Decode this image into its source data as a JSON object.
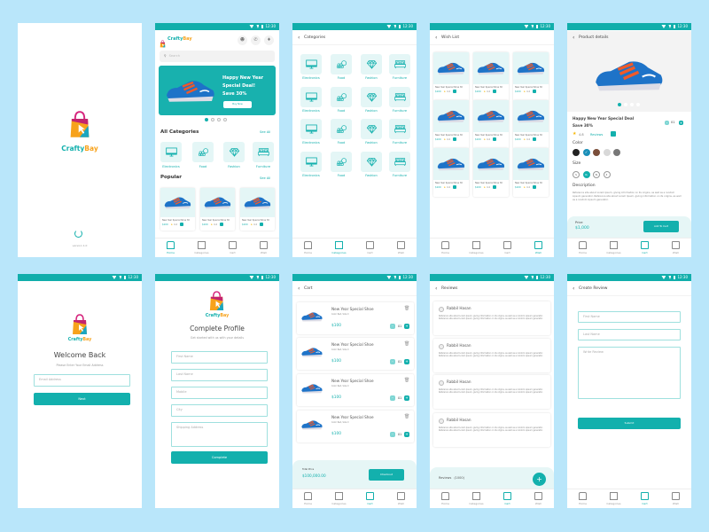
{
  "status": {
    "time": "12:30"
  },
  "brand": {
    "part1": "Crafty",
    "part2": "Bay"
  },
  "nav": [
    "Home",
    "Categories",
    "Cart",
    "Wish"
  ],
  "colors": {
    "teal": "#13b0ad",
    "background": "#b9e6fa",
    "orange": "#f7a21b"
  },
  "splash": {
    "version": "version 1.0"
  },
  "home": {
    "search_placeholder": "Search",
    "banner": {
      "line1": "Happy New Year",
      "line2": "Special Deal!",
      "line3": "Save 30%",
      "button": "Buy Now"
    },
    "all_categories": "All Categories",
    "see_all": "See All",
    "categories": [
      "Electronics",
      "Food",
      "Fashion",
      "Furniture"
    ],
    "popular": "Popular",
    "product": {
      "title": "New Year Special Shoe 30",
      "price": "$100",
      "rating": "4.4"
    }
  },
  "categories_screen": {
    "title": "Categories"
  },
  "wishlist": {
    "title": "Wish List"
  },
  "product_details": {
    "title": "Product details",
    "name_line1": "Happy New Year Special Deal",
    "name_line2": "Save 30%",
    "rating": "4.8",
    "reviews_link": "Reviews",
    "quantity": "01",
    "color_label": "Color",
    "swatches": [
      "#222222",
      "#1a8fb8",
      "#7a4e3a",
      "#d8d8d8",
      "#777777"
    ],
    "size_label": "Size",
    "sizes": [
      "S",
      "XL",
      "3L",
      "X"
    ],
    "description_label": "Description",
    "description": "Reference site about Lorem Ipsum, giving information on its origins, as well as a random Lipsum generator. Reference site about Lorem Ipsum, giving information on its origins, as well as a random Lipsum generator.",
    "price_label": "Price",
    "price": "$1,000",
    "add_to_cart": "Add To Cart"
  },
  "welcome": {
    "title": "Welcome Back",
    "subtitle": "Please Enter Your Email Address",
    "email_placeholder": "Email Address",
    "next": "Next"
  },
  "complete_profile": {
    "title": "Complete Profile",
    "subtitle": "Get started with us with your details",
    "fields": [
      "First Name",
      "Last Name",
      "Mobile",
      "City",
      "Shipping Address"
    ],
    "button": "Complete"
  },
  "cart": {
    "title": "Cart",
    "item": {
      "name": "New Year Special Shoe",
      "variant": "Color Red, Size X",
      "price": "$100",
      "qty": "01"
    },
    "total_label": "Total Price",
    "total": "$100,000.00",
    "checkout": "Checkout"
  },
  "reviews": {
    "title": "Reviews",
    "reviewer": "Rabbil Hasan",
    "text": "Reference site about Lorem Ipsum, giving information on its origins, as well as a random Lipsum generator. Reference site about Lorem Ipsum, giving information on its origins, as well as a random Lipsum generator.",
    "count_label": "Reviews",
    "count": "(1000)"
  },
  "create_review": {
    "title": "Create Review",
    "fields": [
      "First Name",
      "Last Name",
      "Write Review"
    ],
    "submit": "Submit"
  }
}
